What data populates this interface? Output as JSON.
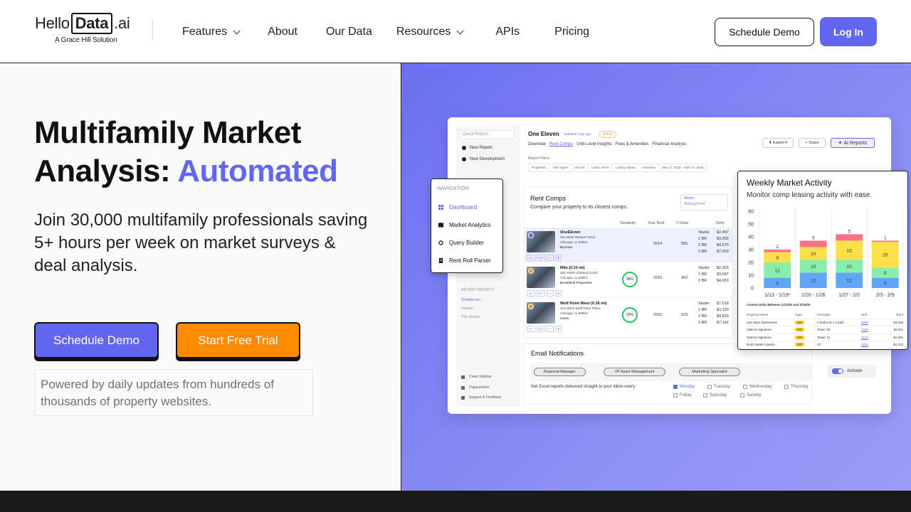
{
  "nav": {
    "logo": {
      "hello": "Hello",
      "data": "Data",
      "ai": ".ai",
      "tagline": "A Grace Hill Solution"
    },
    "links": [
      {
        "label": "Features",
        "dropdown": true
      },
      {
        "label": "About",
        "dropdown": false
      },
      {
        "label": "Our Data",
        "dropdown": false
      },
      {
        "label": "Resources",
        "dropdown": true
      },
      {
        "label": "APIs",
        "dropdown": false
      },
      {
        "label": "Pricing",
        "dropdown": false
      }
    ],
    "schedule_demo": "Schedule Demo",
    "login": "Log In"
  },
  "hero": {
    "title_line1": "Multifamily Market",
    "title_line2_prefix": "Analysis: ",
    "title_line2_accent": "Automated",
    "subtitle": "Join 30,000 multifamily professionals saving 5+ hours per week on market surveys & deal analysis.",
    "cta_primary": "Schedule Demo",
    "cta_secondary": "Start Free Trial",
    "powered": "Powered by daily updates from hundreds of thousands of property websites."
  },
  "dashboard": {
    "sidebar": {
      "search": "Quick Report...",
      "new_report": "New Report",
      "new_development": "New Development",
      "recent_label": "RECENT REPORTS",
      "recent": [
        "OneEleven",
        "Harper",
        "The Arwen"
      ],
      "close_sidebar": "Close Sidebar",
      "organization": "Organization",
      "support": "Support & Feedback"
    },
    "title": "One Eleven",
    "updated": "Updated 1 day ago",
    "status": "Active",
    "tabs": [
      "Overview",
      "Rent Comps",
      "Unit-Level Insights",
      "Fees & Amenities",
      "Financial Analysis"
    ],
    "active_tab": "Rent Comps",
    "buttons": {
      "export": "Export",
      "share": "Share",
      "ai_reports": "AI Reports"
    },
    "filters_label": "Report Filters",
    "filters": [
      "Properties",
      "Unit Types",
      "Unit SF",
      "Lease Terms",
      "Listing Status",
      "Amenities",
      "Mar 17, 2025 - April 17, 2025"
    ],
    "rent_comps": {
      "title": "Rent Comps",
      "subtitle": "Compare your property to its closest comps.",
      "metric_label": "Metric",
      "metric_value": "Asking Rent",
      "headers": {
        "similarity": "Similarity",
        "year_built": "Year Built",
        "units": "# Units",
        "rent": "Rent"
      },
      "rows": [
        {
          "name": "OneEleven",
          "addr1": "111 West Wacker Drive",
          "addr2": "Chicago, IL 60601",
          "owner": "Bozzuto",
          "similarity": "",
          "year": "2014",
          "units": "505",
          "types": [
            "Studio",
            "1 BR",
            "2 BR",
            "3 BR"
          ],
          "rents": [
            "$2,487",
            "$3,309",
            "$4,579",
            "$7,893"
          ],
          "tags": [
            "A+",
            "4.3",
            "—",
            "$"
          ]
        },
        {
          "name": "Mila (0.33 mi)",
          "addr1": "201 North Garland Court",
          "addr2": "Chicago, IL 60601",
          "owner": "Brookfield Properties",
          "similarity": "96%",
          "year": "2016",
          "units": "402",
          "types": [
            "Studio",
            "1 BR",
            "2 BR"
          ],
          "rents": [
            "$2,303",
            "$3,687",
            "$4,063"
          ],
          "tags": [
            "A+",
            "4.7",
            "—",
            "$"
          ]
        },
        {
          "name": "Wolf Point West (0.36 mi)",
          "addr1": "343 West Wolf Point Plaza",
          "addr2": "Chicago, IL 60654",
          "owner": "Hines",
          "similarity": "93%",
          "year": "2015",
          "units": "529",
          "types": [
            "Studio",
            "1 BR",
            "2 BR",
            "3 BR"
          ],
          "rents": [
            "$7,618",
            "$3,120",
            "$4,829",
            "$7,142"
          ],
          "tags": [
            "A+",
            "4.3",
            "—",
            "$"
          ]
        }
      ]
    },
    "email": {
      "title": "Email Notifications",
      "roles": [
        "Regional Manager",
        "VP Asset Management",
        "Marketing Specialist"
      ],
      "activate": "Activate",
      "prompt": "Get Excel reports delivered straight to your inbox every:",
      "days": [
        {
          "label": "Monday",
          "checked": true
        },
        {
          "label": "Tuesday",
          "checked": false
        },
        {
          "label": "Wednesday",
          "checked": false
        },
        {
          "label": "Thursday",
          "checked": false
        },
        {
          "label": "Friday",
          "checked": false
        },
        {
          "label": "Saturday",
          "checked": false
        },
        {
          "label": "Sunday",
          "checked": false
        }
      ]
    }
  },
  "navigation_popup": {
    "title": "NAVIGATION",
    "items": [
      "Dashboard",
      "Market Analytics",
      "Query Builder",
      "Rent Roll Parser"
    ],
    "active": "Dashboard"
  },
  "weekly": {
    "title": "Weekly Market Activity",
    "subtitle": "Monitor comp leasing activity with ease.",
    "leased_label": "Leased Units Between 1/13/25 and 3/16/25",
    "table_headers": [
      "Property Name",
      "Type",
      "Floorplan",
      "Unit",
      "Rent"
    ],
    "table_rows": [
      [
        "215 West Apartments",
        "A/2",
        "2 bedroom / 2 bath",
        "3606",
        "$3,009"
      ],
      [
        "Optima Signature",
        "A/2",
        "Tower 06",
        "3400",
        "$4,511"
      ],
      [
        "Optima Signature",
        "A/2",
        "Tower 12",
        "2612",
        "$4,681"
      ],
      [
        "North Water Apartm...",
        "A/2",
        "2C",
        "4010",
        "$4,313"
      ]
    ],
    "colors": {
      "blue": "#60a5fa",
      "green": "#86efac",
      "yellow": "#fde047",
      "red": "#fb7185"
    }
  },
  "chart_data": {
    "type": "bar",
    "stacked": true,
    "categories": [
      "1/13 - 1/19*",
      "1/20 - 1/26",
      "1/27 - 2/2",
      "2/3 - 2/9"
    ],
    "ylim": [
      0,
      60
    ],
    "yticks": [
      0,
      10,
      20,
      30,
      40,
      50,
      60
    ],
    "grid": true,
    "series": [
      {
        "color": "#60a5fa",
        "values": [
          8,
          12,
          12,
          8
        ]
      },
      {
        "color": "#86efac",
        "values": [
          12,
          10,
          10,
          8
        ]
      },
      {
        "color": "#fde047",
        "values": [
          8,
          10,
          15,
          20
        ]
      },
      {
        "color": "#fb7185",
        "values": [
          2,
          5,
          5,
          1
        ]
      }
    ]
  }
}
